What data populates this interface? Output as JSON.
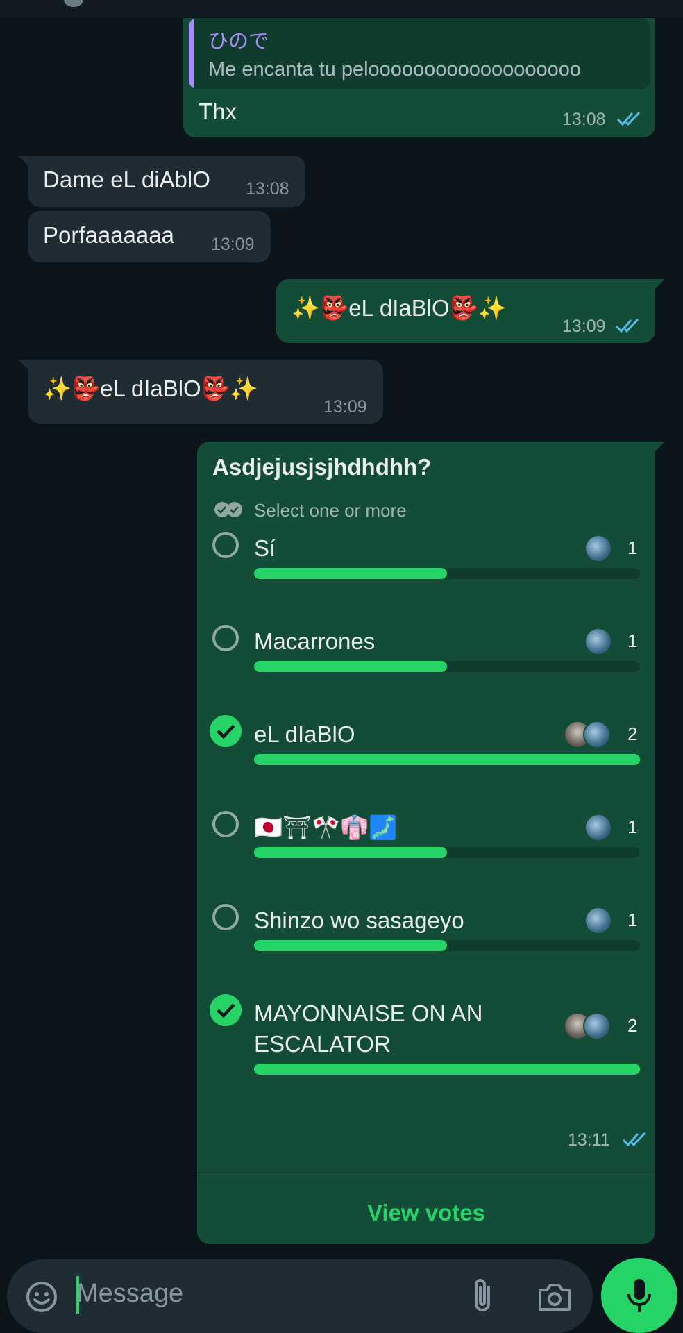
{
  "colors": {
    "background": "#0b141a",
    "outgoing_bubble": "#144d37",
    "incoming_bubble": "#202c33",
    "accent_green": "#25d366",
    "read_ticks": "#53bdeb",
    "quote_author": "#a78bfa"
  },
  "messages": {
    "reply": {
      "quote_author": "ひので",
      "quote_text": "Me encanta tu pelooooooooooooooooooo",
      "text": "Thx",
      "time": "13:08",
      "status_icon": "double-check-read"
    },
    "in1": {
      "text": "Dame eL diAblO",
      "time": "13:08"
    },
    "in2": {
      "text": "Porfaaaaaaa",
      "time": "13:09"
    },
    "out2": {
      "sparkle": "✨",
      "demon": "👺",
      "text": "eL dIaBlO",
      "time": "13:09",
      "status_icon": "double-check-read"
    },
    "in3": {
      "sparkle": "✨",
      "demon": "👺",
      "text": "eL dIaBlO",
      "time": "13:09"
    }
  },
  "poll": {
    "question": "Asdjejusjsjhdhdhh?",
    "subtitle": "Select one or more",
    "options": [
      {
        "label": "Sí",
        "votes": "1",
        "fraction": 0.5,
        "selected": false
      },
      {
        "label": "Macarrones",
        "votes": "1",
        "fraction": 0.5,
        "selected": false
      },
      {
        "label": "eL dIaBlO",
        "votes": "2",
        "fraction": 1.0,
        "selected": true
      },
      {
        "label": "🇯🇵⛩🎌👘🗾",
        "votes": "1",
        "fraction": 0.5,
        "selected": false
      },
      {
        "label": "Shinzo wo sasageyo",
        "votes": "1",
        "fraction": 0.5,
        "selected": false
      },
      {
        "label": "MAYONNAISE ON AN ESCALATOR",
        "votes": "2",
        "fraction": 1.0,
        "selected": true
      }
    ],
    "time": "13:11",
    "status_icon": "double-check-read",
    "view_votes": "View votes"
  },
  "composer": {
    "placeholder": "Message",
    "icons": [
      "emoji-icon",
      "attach-icon",
      "camera-icon",
      "mic-icon"
    ]
  }
}
